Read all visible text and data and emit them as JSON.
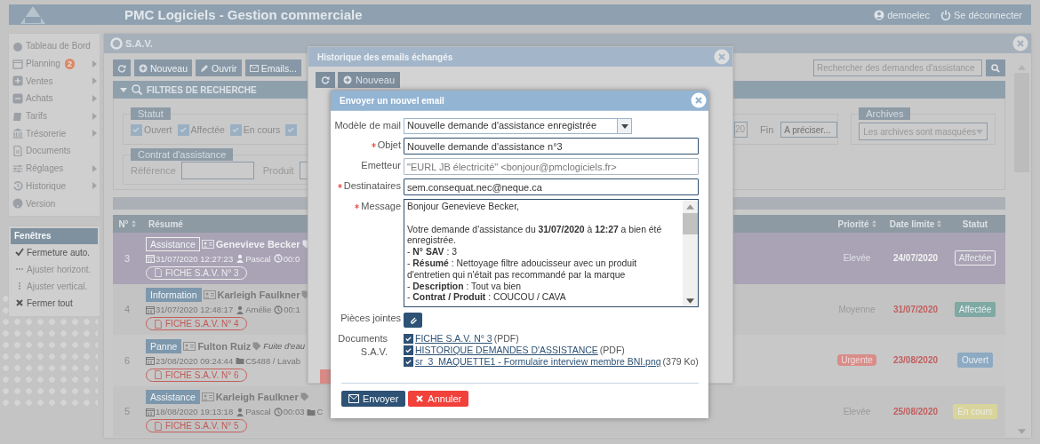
{
  "header": {
    "title": "PMC Logiciels - Gestion commerciale",
    "user": "demoelec",
    "logout": "Se déconnecter"
  },
  "sidebar": {
    "items": [
      {
        "label": "Tableau de Bord",
        "submenu": false
      },
      {
        "label": "Planning",
        "badge": "2",
        "submenu": true
      },
      {
        "label": "Ventes",
        "submenu": true
      },
      {
        "label": "Achats",
        "submenu": true
      },
      {
        "label": "Tarifs",
        "submenu": true
      },
      {
        "label": "Trésorerie",
        "submenu": true
      },
      {
        "label": "Documents",
        "submenu": false
      },
      {
        "label": "Réglages",
        "submenu": true
      },
      {
        "label": "Historique",
        "submenu": true
      },
      {
        "label": "Version",
        "submenu": false
      }
    ]
  },
  "windows_menu": {
    "title": "Fenêtres",
    "items": [
      {
        "label": "Fermeture auto.",
        "disabled": false
      },
      {
        "label": "Ajuster horizont.",
        "disabled": true
      },
      {
        "label": "Ajuster vertical.",
        "disabled": true
      },
      {
        "label": "Fermer tout",
        "disabled": false
      }
    ]
  },
  "sav_window": {
    "title": "S.A.V.",
    "toolbar": [
      "Nouveau",
      "Ouvrir",
      "Emails..."
    ],
    "search_placeholder": "Rechercher des demandes d'assistance",
    "filters": {
      "title": "FILTRES DE RECHERCHE",
      "status_legend": "Statut",
      "statuses": [
        {
          "label": "Ouvert",
          "checked": true
        },
        {
          "label": "Affectée",
          "checked": true
        },
        {
          "label": "En cours",
          "checked": true
        },
        {
          "checked": true
        }
      ],
      "start_value": "20",
      "end_label": "Fin",
      "end_placeholder": "A préciser...",
      "archives_legend": "Archives",
      "archives_value": "Les archives sont masquées",
      "contract_legend": "Contrat d'assistance",
      "reference_label": "Référence",
      "product_label": "Produit"
    },
    "table": {
      "columns": [
        {
          "label": "N°",
          "sortable": true
        },
        {
          "label": "Résumé",
          "sortable": false
        },
        {
          "label": "Priorité",
          "sortable": true
        },
        {
          "label": "Date limite",
          "sortable": true
        },
        {
          "label": "Statut",
          "sortable": false
        }
      ],
      "rows": [
        {
          "number": "3",
          "selected": true,
          "tag": "Assistance",
          "client": "Genevieve Becker",
          "meta": [
            {
              "kind": "date",
              "text": "31/07/2020 12:27:23"
            },
            {
              "kind": "user",
              "text": "Pascal"
            },
            {
              "kind": "time",
              "text": "00:0"
            }
          ],
          "fiche": "FICHE S.A.V. N° 3",
          "priority": "Elevée",
          "priority_badge": false,
          "deadline": "24/07/2020",
          "status": "Affectée"
        },
        {
          "number": "4",
          "selected": false,
          "tag": "Information",
          "client": "Karleigh Faulkner",
          "meta": [
            {
              "kind": "date",
              "text": "31/07/2020 12:48:17"
            },
            {
              "kind": "user",
              "text": "Amélie"
            },
            {
              "kind": "time",
              "text": "00:1"
            }
          ],
          "fiche": "FICHE S.A.V. N° 4",
          "priority": "Moyenne",
          "priority_badge": false,
          "deadline": "31/07/2020",
          "status": "Affectée",
          "color": "#7fa9a3"
        },
        {
          "number": "6",
          "selected": false,
          "tag": "Panne",
          "client": "Fulton Ruiz",
          "subject": "Fuite d'eau",
          "meta": [
            {
              "kind": "date",
              "text": "23/08/2020 09:24:44"
            },
            {
              "kind": "folder",
              "text": "C5488 / Lavab"
            }
          ],
          "fiche": "FICHE S.A.V. N° 6",
          "priority": "Urgente",
          "priority_badge": true,
          "deadline": "23/08/2020",
          "status": "Ouvert",
          "color": "#8eaac3"
        },
        {
          "number": "5",
          "selected": false,
          "tag": "Assistance",
          "client": "Karleigh Faulkner",
          "meta": [
            {
              "kind": "date",
              "text": "18/08/2020 19:13:18"
            },
            {
              "kind": "user",
              "text": "Pascal"
            },
            {
              "kind": "time",
              "text": "00:03"
            },
            {
              "kind": "folder",
              "text": "C"
            }
          ],
          "fiche": "FICHE S.A.V. N° 5",
          "priority": "Elevée",
          "priority_badge": false,
          "deadline": "25/08/2020",
          "status": "En cours",
          "color": "#d9d49b"
        }
      ]
    }
  },
  "history_window": {
    "title": "Historique des emails échangés",
    "new_button": "Nouveau"
  },
  "email_dialog": {
    "title": "Envoyer un nouvel email",
    "fields": [
      {
        "kind": "select",
        "label": "Modèle de mail",
        "required": false,
        "value": "Nouvelle demande d'assistance enregistrée"
      },
      {
        "kind": "text",
        "label": "Objet",
        "required": true,
        "value": "Nouvelle demande d'assistance n°3"
      },
      {
        "kind": "readonly",
        "label": "Emetteur",
        "required": false,
        "value": "\"EURL JB électricité\" <bonjour@pmclogiciels.fr>"
      },
      {
        "kind": "text",
        "label": "Destinataires",
        "required": true,
        "value": "sem.consequat.nec@neque.ca"
      },
      {
        "kind": "textarea",
        "label": "Message",
        "required": true,
        "paragraphs": [
          [
            "Bonjour Genevieve Becker,"
          ],
          [
            "Votre demande d'assistance du **31/07/2020** à **12:27** a bien été enregistrée.",
            "- **N° SAV** : 3",
            "- **Résumé** : Nettoyage filtre adoucisseur avec un produit d'entretien qui n'était pas recommandé par la marque",
            "- **Description** : Tout va bien",
            "- **Contrat / Produit** : COUCOU / CAVA"
          ]
        ]
      }
    ],
    "attachments_label": "Pièces jointes",
    "documents_label": "Documents S.A.V.",
    "documents": [
      {
        "name": "FICHE S.A.V. N° 3",
        "suffix": "(PDF)",
        "checked": true
      },
      {
        "name": "HISTORIQUE DEMANDES D'ASSISTANCE",
        "suffix": "(PDF)",
        "checked": true
      },
      {
        "name": "sr_3_MAQUETTE1 - Formulaire interview membre BNI.png",
        "suffix": "(379 Ko)",
        "checked": true
      }
    ],
    "send_button": "Envoyer",
    "cancel_button": "Annuler"
  }
}
